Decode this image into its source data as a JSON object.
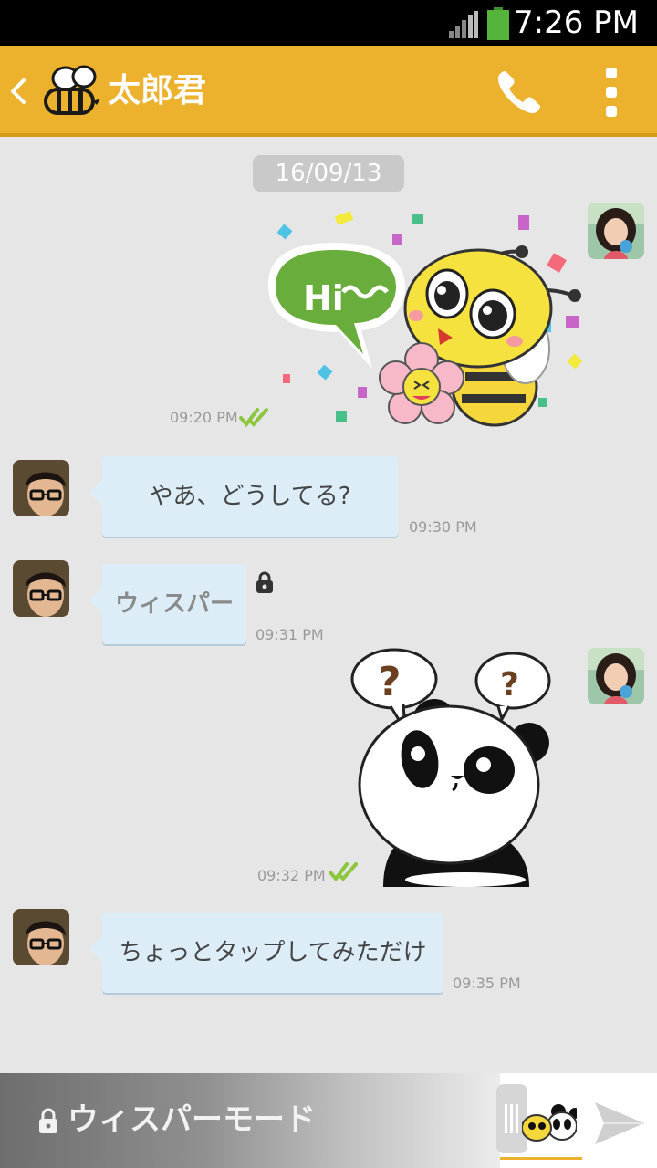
{
  "status_bar": {
    "time": "7:26 PM",
    "icons": [
      "signal-icon",
      "battery-icon"
    ]
  },
  "header": {
    "contact_name": "太郎君",
    "icons": [
      "back-icon",
      "bee-logo-icon",
      "phone-icon",
      "more-vert-icon"
    ]
  },
  "chat": {
    "date": "16/09/13",
    "messages": [
      {
        "from": "me",
        "type": "sticker",
        "sticker": "bee-hi-sticker",
        "bubble_text": "Hi~~",
        "time": "09:20 PM",
        "read": true
      },
      {
        "from": "other",
        "type": "text",
        "text": "やあ、どうしてる?",
        "time": "09:30 PM"
      },
      {
        "from": "other",
        "type": "whisper",
        "text": "ウィスパー",
        "time": "09:31 PM",
        "locked": true
      },
      {
        "from": "me",
        "type": "sticker",
        "sticker": "panda-question-sticker",
        "bubble_text": "?",
        "time": "09:32 PM",
        "read": true
      },
      {
        "from": "other",
        "type": "text",
        "text": "ちょっとタップしてみただけ",
        "time": "09:35 PM"
      }
    ]
  },
  "bottom_bar": {
    "whisper_mode_label": "ウィスパーモード",
    "icons": [
      "lock-icon",
      "sticker-icon",
      "send-icon"
    ]
  },
  "colors": {
    "header": "#ecb22e",
    "bubble": "#dcedf7",
    "read_check": "#8cc63f",
    "background": "#e6e6e6"
  }
}
